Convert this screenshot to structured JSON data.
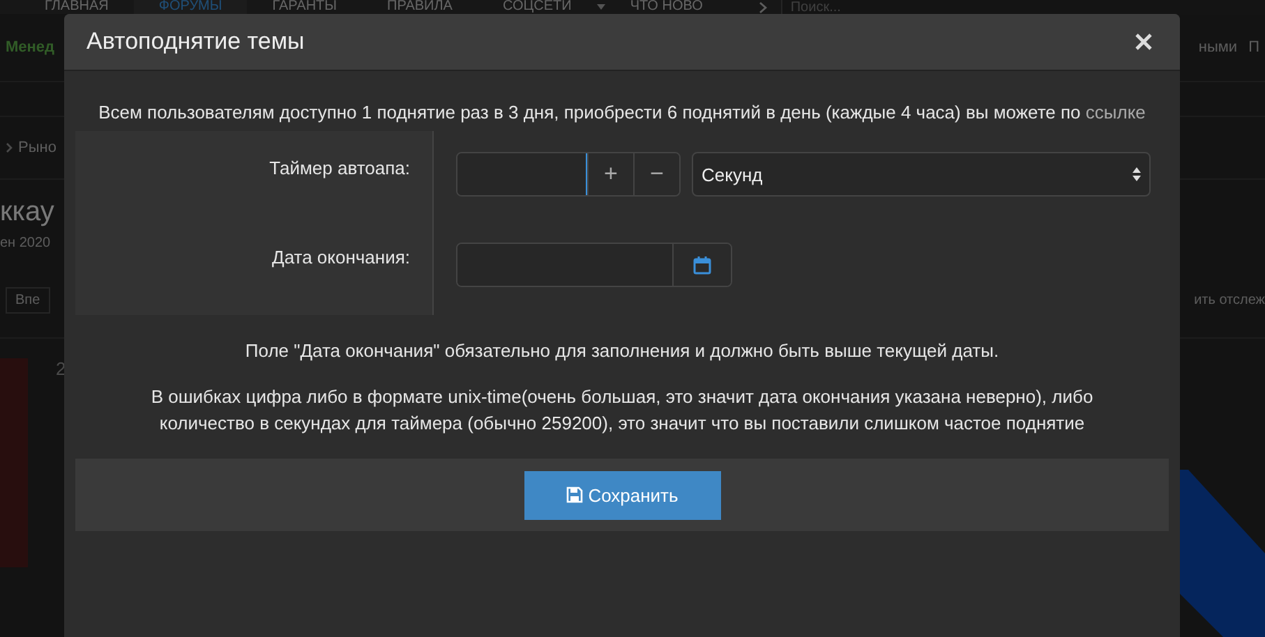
{
  "page": {
    "nav": [
      {
        "label": "ГЛАВНАЯ",
        "selected": false
      },
      {
        "label": "ФОРУМЫ",
        "selected": true
      },
      {
        "label": "ГАРАНТЫ",
        "selected": false
      },
      {
        "label": "ПРАВИЛА",
        "selected": false
      },
      {
        "label": "СОЦСЕТИ",
        "selected": false
      },
      {
        "label": "ЧТО НОВО",
        "selected": false
      }
    ],
    "search": {
      "placeholder": "Поиск..."
    },
    "subnav_left": "Менед",
    "subnav_right": [
      "ными",
      "П"
    ],
    "breadcrumb": "Рыно",
    "title": "ккау",
    "date": "ен 2020",
    "button": "Впе",
    "follow_link": "ить отслеж",
    "post_number": "2"
  },
  "dialog": {
    "title": "Автоподнятие темы",
    "intro": "Всем пользователям доступно 1 поднятие раз в 3 дня, приобрести 6 поднятий в день (каждые 4 часа) вы можете по",
    "intro_link": "ссылке",
    "timer": {
      "label": "Таймер автоапа:",
      "plus": "+",
      "minus": "−",
      "unit": "Секунд"
    },
    "end_date": {
      "label": "Дата окончания:"
    },
    "notes": [
      "Поле \"Дата окончания\" обязательно для заполнения и должно быть выше текущей даты.",
      "В ошибках цифра либо в формате unix-time(очень большая, это значит дата окончания указана неверно), либо количество в секундах для таймера (обычно 259200), это значит что вы поставили слишком частое поднятие"
    ],
    "save": "Сохранить"
  }
}
